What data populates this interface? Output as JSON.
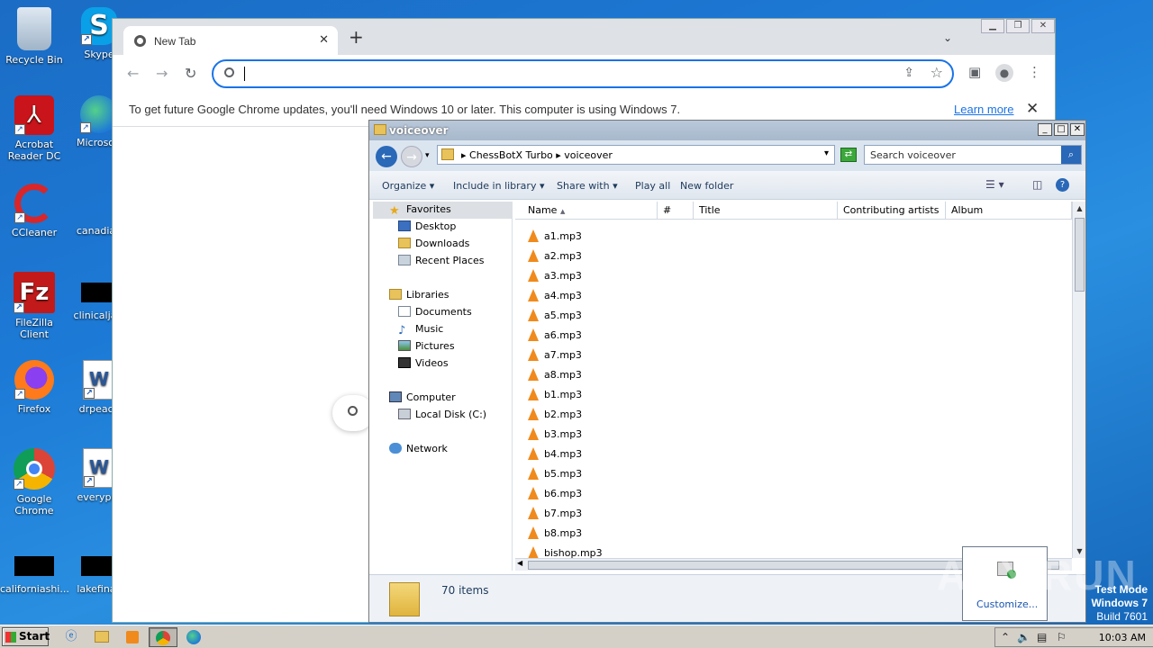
{
  "desktop": {
    "icons": [
      {
        "label": "Recycle Bin"
      },
      {
        "label": "Skype"
      },
      {
        "label": "Acrobat Reader DC"
      },
      {
        "label": "Microsoft"
      },
      {
        "label": "CCleaner"
      },
      {
        "label": "canadian"
      },
      {
        "label": "FileZilla Client"
      },
      {
        "label": "clinicaljacl"
      },
      {
        "label": "Firefox"
      },
      {
        "label": "drpeace"
      },
      {
        "label": "Google Chrome"
      },
      {
        "label": "everypre"
      },
      {
        "label": "californiashi..."
      },
      {
        "label": "lakefinall"
      }
    ]
  },
  "chrome": {
    "tab_title": "New Tab",
    "tab_close": "✕",
    "new_tab": "+",
    "tab_search": "⌄",
    "win_buttons": [
      "▁",
      "❐",
      "✕"
    ],
    "omnibox_value": "",
    "infobar_message": "To get future Google Chrome updates, you'll need Windows 10 or later. This computer is using Windows 7.",
    "infobar_link": "Learn more",
    "infobar_close": "✕"
  },
  "explorer": {
    "title": "voiceover",
    "breadcrumb": "▸ ChessBotX Turbo ▸ voiceover",
    "search_placeholder": "Search voiceover",
    "commands": [
      "Organize ▾",
      "Include in library ▾",
      "Share with ▾",
      "Play all",
      "New folder"
    ],
    "nav": {
      "favorites": "Favorites",
      "desktop": "Desktop",
      "downloads": "Downloads",
      "recent": "Recent Places",
      "libraries": "Libraries",
      "documents": "Documents",
      "music": "Music",
      "pictures": "Pictures",
      "videos": "Videos",
      "computer": "Computer",
      "local_disk": "Local Disk (C:)",
      "network": "Network"
    },
    "columns": [
      "Name",
      "#",
      "Title",
      "Contributing artists",
      "Album"
    ],
    "files": [
      "a1.mp3",
      "a2.mp3",
      "a3.mp3",
      "a4.mp3",
      "a5.mp3",
      "a6.mp3",
      "a7.mp3",
      "a8.mp3",
      "b1.mp3",
      "b2.mp3",
      "b3.mp3",
      "b4.mp3",
      "b5.mp3",
      "b6.mp3",
      "b7.mp3",
      "b8.mp3",
      "bishop.mp3"
    ],
    "item_count": "70 items"
  },
  "tray_flyout": {
    "customize": "Customize..."
  },
  "watermark": "ANY RUN",
  "testmode": {
    "line1": "Test Mode",
    "line2": "Windows 7",
    "line3": "Build 7601"
  },
  "taskbar": {
    "start": "Start",
    "clock": "10:03 AM"
  }
}
